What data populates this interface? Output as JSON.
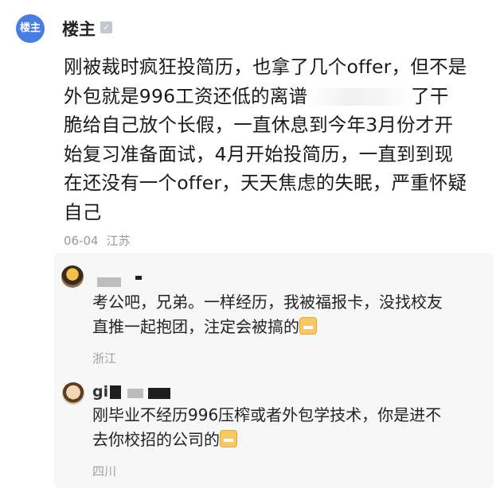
{
  "op": {
    "avatar_label": "楼主",
    "name": "楼主",
    "verify_icon": "✓",
    "post_lines": [
      "刚被裁时疯狂投简历，也拿了几个offer，但不是",
      "外包就是996工资还低的离谱",
      "了干",
      "脆给自己放个长假，一直休息到今年3月份才开",
      "始复习准备面试，4月开始投简历，一直到到现",
      "在还没有一个offer，天天焦虑的失眠，严重怀疑",
      "自己"
    ],
    "date": "06-04",
    "location": "江苏"
  },
  "replies": [
    {
      "name": "",
      "lines": [
        "考公吧，兄弟。一样经历，我被福报卡，没找校友",
        "直推一起抱团，注定会被搞的"
      ],
      "location": "浙江"
    },
    {
      "name": "gi",
      "lines": [
        "刚毕业不经历996压榨或者外包学技术，你是进不",
        "去你校招的公司的"
      ],
      "location": "四川"
    }
  ]
}
